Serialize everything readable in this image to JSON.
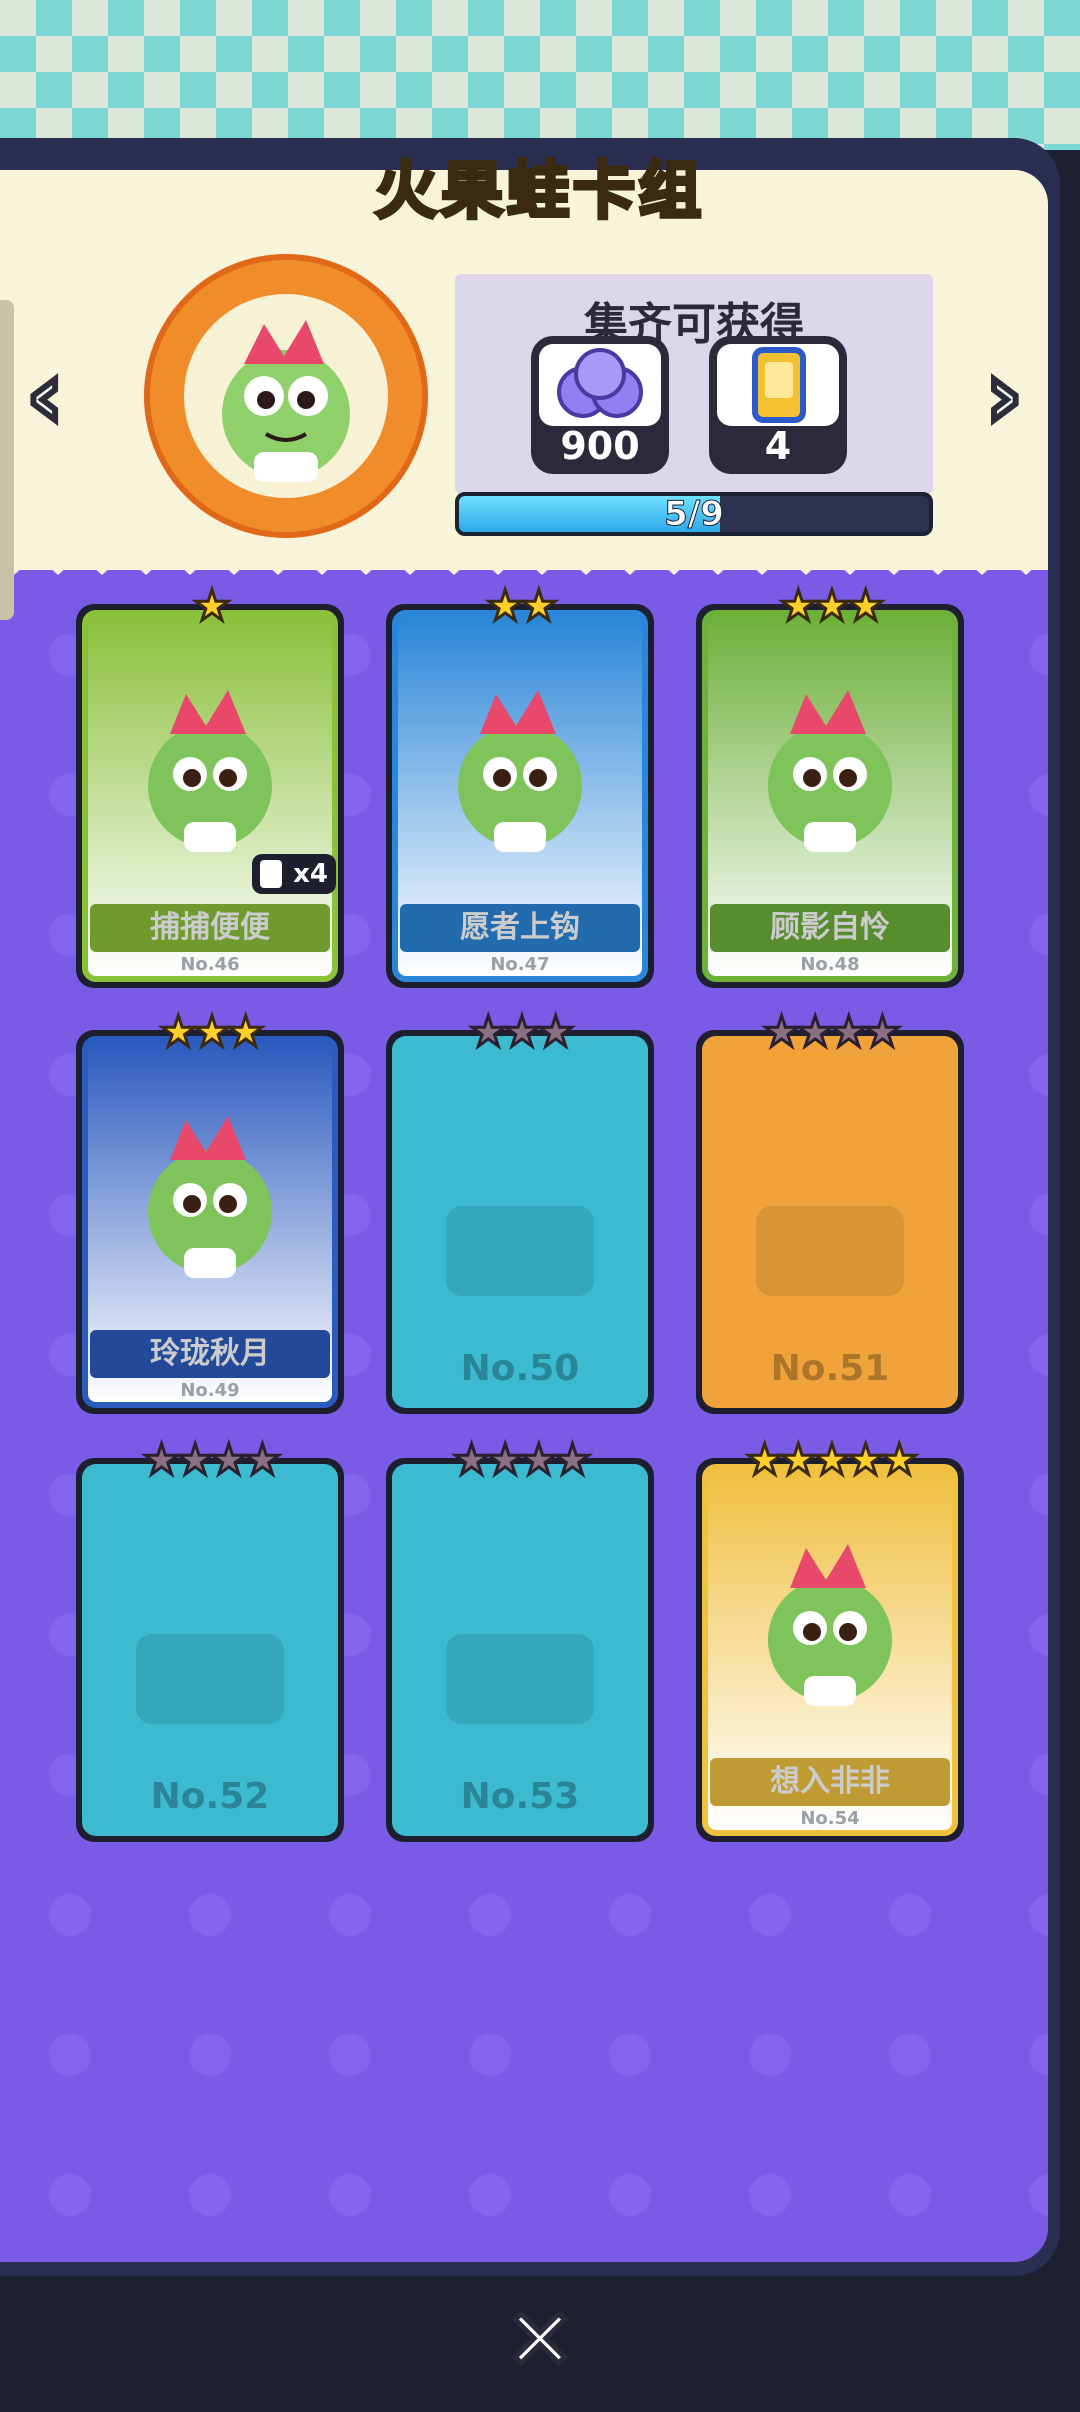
{
  "header": {
    "title": "火果蛙卡组"
  },
  "nav": {
    "prev_icon": "chevron-left-icon",
    "next_icon": "chevron-right-icon",
    "prev_label": "‹",
    "next_label": "›"
  },
  "medal": {
    "icon": "frog-medal-icon"
  },
  "reward": {
    "heading": "集齐可获得",
    "items": [
      {
        "icon": "crystal-orbs-icon",
        "count": "900"
      },
      {
        "icon": "card-pack-icon",
        "count": "4"
      }
    ]
  },
  "progress": {
    "label": "5/9",
    "fraction": 0.5556
  },
  "cards": [
    {
      "name": "捕捕便便",
      "number": "No.46",
      "stars": 1,
      "max_stars": 1,
      "owned": true,
      "dup": "x4",
      "theme": "#8ac03a"
    },
    {
      "name": "愿者上钩",
      "number": "No.47",
      "stars": 2,
      "max_stars": 2,
      "owned": true,
      "dup": "",
      "theme": "#2a86d8"
    },
    {
      "name": "顾影自怜",
      "number": "No.48",
      "stars": 3,
      "max_stars": 3,
      "owned": true,
      "dup": "",
      "theme": "#6db03a"
    },
    {
      "name": "玲珑秋月",
      "number": "No.49",
      "stars": 3,
      "max_stars": 3,
      "owned": true,
      "dup": "",
      "theme": "#2c5bbf"
    },
    {
      "name": "",
      "number": "No.50",
      "stars": 0,
      "max_stars": 3,
      "owned": false,
      "dup": "",
      "theme": "#3bbad0"
    },
    {
      "name": "",
      "number": "No.51",
      "stars": 0,
      "max_stars": 4,
      "owned": false,
      "dup": "",
      "theme": "#f0a33a"
    },
    {
      "name": "",
      "number": "No.52",
      "stars": 0,
      "max_stars": 4,
      "owned": false,
      "dup": "",
      "theme": "#3bbad0"
    },
    {
      "name": "",
      "number": "No.53",
      "stars": 0,
      "max_stars": 4,
      "owned": false,
      "dup": "",
      "theme": "#3bbad0"
    },
    {
      "name": "想入非非",
      "number": "No.54",
      "stars": 5,
      "max_stars": 5,
      "owned": true,
      "dup": "",
      "theme": "#f0c040"
    }
  ],
  "footer": {
    "close_icon": "close-icon",
    "close_label": "✕"
  }
}
